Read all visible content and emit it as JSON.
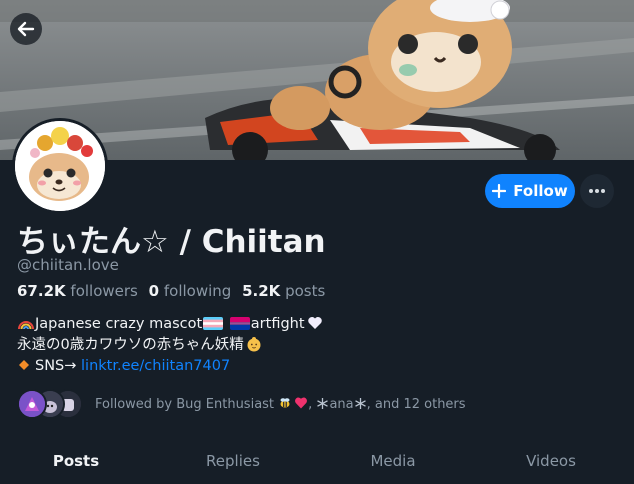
{
  "profile": {
    "display_name": "ちぃたん☆ / Chiitan",
    "handle": "@chiitan.love"
  },
  "actions": {
    "follow_label": "Follow"
  },
  "stats": {
    "followers_count": "67.2K",
    "followers_label": "followers",
    "following_count": "0",
    "following_label": "following",
    "posts_count": "5.2K",
    "posts_label": "posts"
  },
  "bio": {
    "line1_part1": "Japanese crazy mascot",
    "line1_part2": "artfight",
    "line2": "永遠の0歳カワウソの赤ちゃん妖精",
    "line3_prefix": "SNS→ ",
    "link": "linktr.ee/chiitan7407"
  },
  "followed_by": {
    "prefix": "Followed by Bug Enthusiast",
    "name2": "ana",
    "suffix": ", and 12 others"
  },
  "tabs": [
    "Posts",
    "Replies",
    "Media",
    "Videos"
  ],
  "colors": {
    "background": "#161e27",
    "accent": "#1083fe",
    "muted_text": "#8b98a5"
  },
  "icons": {
    "back": "arrow-left-icon",
    "follow": "plus-icon",
    "more": "ellipsis-icon"
  }
}
